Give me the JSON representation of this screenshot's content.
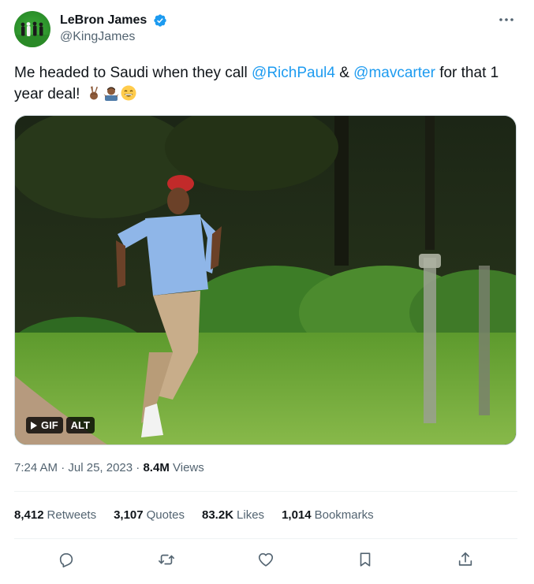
{
  "author": {
    "display_name": "LeBron James",
    "handle": "@KingJames",
    "verified": true,
    "avatar_icon": "avatar-image",
    "verified_icon": "verified-badge-icon",
    "verified_color": "#1d9bf0"
  },
  "tweet": {
    "text_before": "Me headed to Saudi when they call ",
    "mention_1": "@RichPaul4",
    "text_middle": " & ",
    "mention_2": "@mavcarter",
    "text_after": " for that 1 year deal! ",
    "emojis": [
      "victory-hand-emoji",
      "person-shrugging-emoji",
      "grinning-face-emoji"
    ]
  },
  "media": {
    "type_badge": "GIF",
    "alt_badge": "ALT",
    "play_icon": "play-icon"
  },
  "meta": {
    "time": "7:24 AM",
    "separator": " · ",
    "date": "Jul 25, 2023",
    "views_count": "8.4M",
    "views_label": "Views"
  },
  "stats": [
    {
      "count": "8,412",
      "label": "Retweets"
    },
    {
      "count": "3,107",
      "label": "Quotes"
    },
    {
      "count": "83.2K",
      "label": "Likes"
    },
    {
      "count": "1,014",
      "label": "Bookmarks"
    }
  ],
  "actions": [
    "reply-icon",
    "retweet-icon",
    "like-icon",
    "bookmark-icon",
    "share-icon"
  ],
  "colors": {
    "link": "#1d9bf0",
    "secondary_text": "#536471",
    "primary_text": "#0f1419",
    "divider": "#eff3f4"
  }
}
